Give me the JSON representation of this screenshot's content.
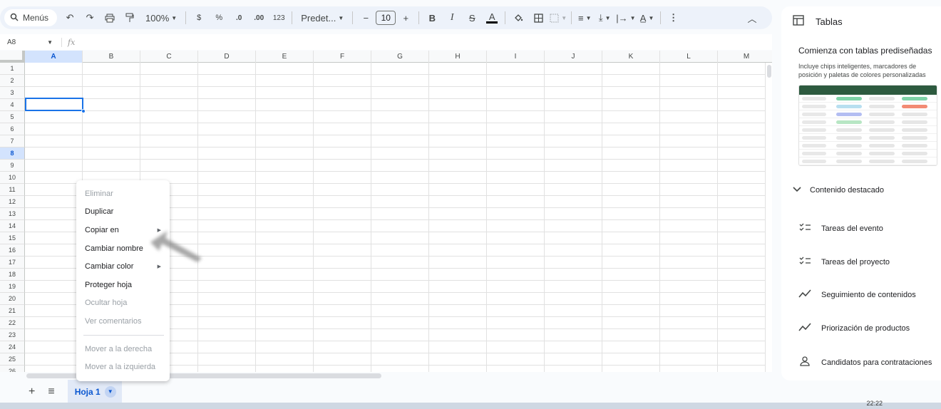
{
  "toolbar": {
    "menus_label": "Menús",
    "zoom": "100%",
    "currency": "$",
    "percent": "%",
    "dec_less": ".0",
    "dec_more": ".00",
    "number_format": "123",
    "font": "Predet...",
    "font_size": "10",
    "bold": "B",
    "italic": "I",
    "text_color": "A"
  },
  "formula_bar": {
    "cell_ref": "A8",
    "fx": "fx"
  },
  "grid": {
    "columns": [
      "A",
      "B",
      "C",
      "D",
      "E",
      "F",
      "G",
      "H",
      "I",
      "J",
      "K",
      "L",
      "M"
    ],
    "rows": [
      "1",
      "2",
      "3",
      "4",
      "5",
      "6",
      "7",
      "8",
      "9",
      "10",
      "11",
      "12",
      "13",
      "14",
      "15",
      "16",
      "17",
      "18",
      "19",
      "20",
      "21",
      "22",
      "23",
      "24",
      "25",
      "26"
    ],
    "selected_cell": "A8"
  },
  "context_menu": {
    "items": [
      {
        "label": "Eliminar",
        "enabled": false
      },
      {
        "label": "Duplicar",
        "enabled": true
      },
      {
        "label": "Copiar en",
        "enabled": true,
        "submenu": true
      },
      {
        "label": "Cambiar nombre",
        "enabled": true
      },
      {
        "label": "Cambiar color",
        "enabled": true,
        "submenu": true
      },
      {
        "label": "Proteger hoja",
        "enabled": true
      },
      {
        "label": "Ocultar hoja",
        "enabled": false
      },
      {
        "label": "Ver comentarios",
        "enabled": false
      },
      {
        "label": "Mover a la derecha",
        "enabled": false
      },
      {
        "label": "Mover a la izquierda",
        "enabled": false
      }
    ]
  },
  "sheets": {
    "add": "+",
    "list": "≡",
    "active_tab": "Hoja 1"
  },
  "side_panel": {
    "title": "Tablas",
    "heading": "Comienza con tablas prediseñadas",
    "description": "Incluye chips inteligentes, marcadores de posición y paletas de colores personalizadas",
    "featured": "Contenido destacado",
    "templates": [
      {
        "label": "Tareas del evento",
        "icon": "checklist-icon"
      },
      {
        "label": "Tareas del proyecto",
        "icon": "checklist-icon"
      },
      {
        "label": "Seguimiento de contenidos",
        "icon": "trend-icon"
      },
      {
        "label": "Priorización de productos",
        "icon": "trend-icon"
      },
      {
        "label": "Candidatos para contrataciones",
        "icon": "person-icon"
      }
    ]
  },
  "taskbar": {
    "clock": "22:22"
  },
  "colors": {
    "accent": "#1a73e8",
    "toolbar_bg": "#edf2fa",
    "selection_header": "#d3e3fd",
    "preview_header": "#2d5a3f"
  }
}
